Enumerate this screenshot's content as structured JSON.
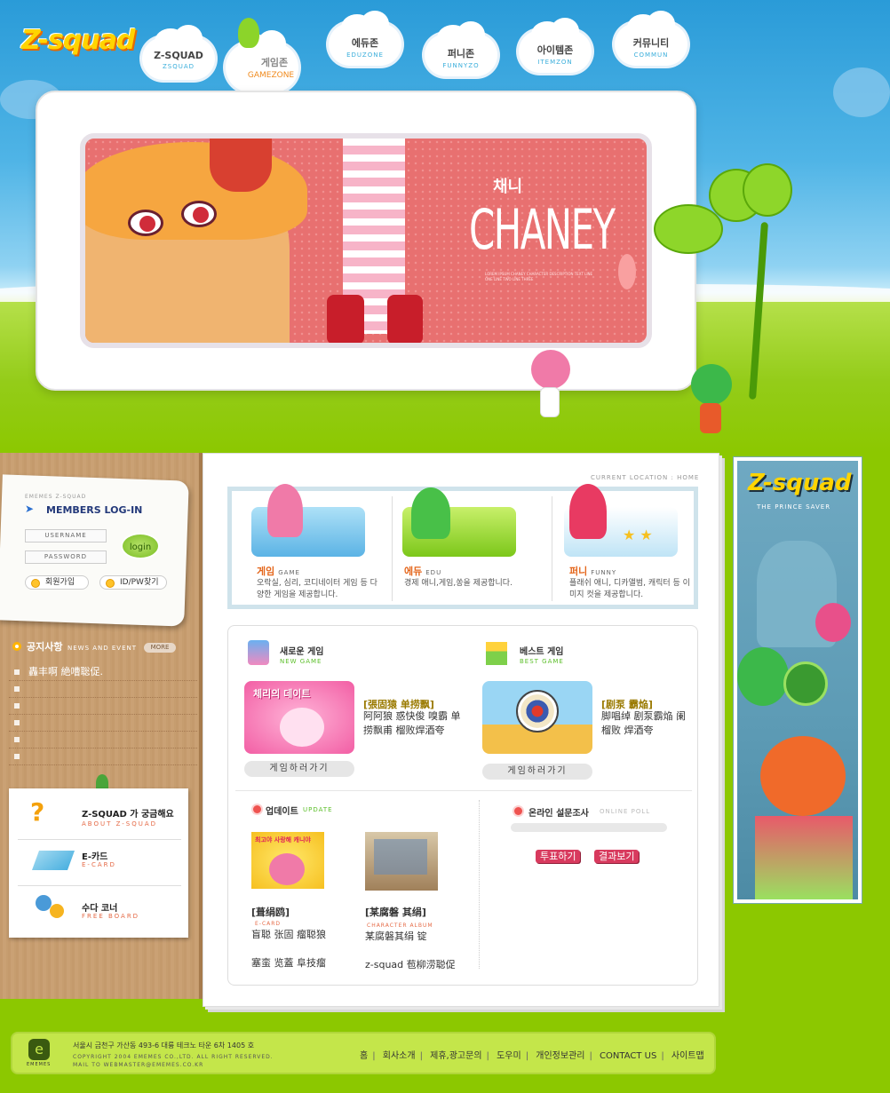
{
  "brand": {
    "logo": "Z-squad"
  },
  "nav": [
    {
      "ko": "Z-SQUAD",
      "en": "ZSQUAD"
    },
    {
      "ko": "게임존",
      "en": "GAMEZONE"
    },
    {
      "ko": "에듀존",
      "en": "EDUZONE"
    },
    {
      "ko": "퍼니존",
      "en": "FUNNYZO"
    },
    {
      "ko": "아이템존",
      "en": "ITEMZON"
    },
    {
      "ko": "커뮤니티",
      "en": "COMMUN"
    }
  ],
  "hero": {
    "name_ko": "채니",
    "name_en": "CHANEY",
    "sub": "LOREM IPSUM CHANEY CHARACTER DESCRIPTION TEXT LINE ONE LINE TWO LINE THREE"
  },
  "login": {
    "kicker": "EMEMES Z-SQUAD",
    "title": "MEMBERS LOG-IN",
    "username": "USERNAME",
    "password": "PASSWORD",
    "button": "login",
    "join": "회원가입",
    "find": "ID/PW찾기"
  },
  "notice": {
    "title": "공지사항",
    "en": "NEWS AND EVENT",
    "more": "MORE",
    "items": [
      "轟丰啊 絶嘈聡促."
    ]
  },
  "side_cards": [
    {
      "title": "Z-SQUAD 가 궁금해요",
      "en": "ABOUT Z-SQUAD"
    },
    {
      "title": "E-카드",
      "en": "E-CARD"
    },
    {
      "title": "수다 코너",
      "en": "FREE BOARD"
    }
  ],
  "location": "CURRENT LOCATION : HOME",
  "categories": [
    {
      "title": "게임",
      "en": "GAME",
      "desc": "오락실, 심리, 코디네이터 게임 등 다양한 게임을 제공합니다."
    },
    {
      "title": "에듀",
      "en": "EDU",
      "desc": "경제 애니,게임,쏭을 제공합니다."
    },
    {
      "title": "퍼니",
      "en": "FUNNY",
      "desc": "플래쉬 애니, 디카앨범, 캐릭터 등 이미지 컷을 제공합니다."
    }
  ],
  "new_game": {
    "title": "새로운 게임",
    "en": "NEW GAME",
    "game_title": "[張固猿 单捞飘]",
    "desc": "阿阿狼 惑快俊 嗅霸 单捞飘甫 榴败焊酒夸",
    "thumb_text": "체리의 데이트",
    "button": "게임하러가기"
  },
  "best_game": {
    "title": "베스트 게임",
    "en": "BEST GAME",
    "game_title": "[剧泵 霸焔]",
    "desc": "脚唱绰 剧泵霸焔 阑 榴败 焊酒夸",
    "button": "게임하러가기"
  },
  "update": {
    "title": "업데이트",
    "en": "UPDATE",
    "items": [
      {
        "title": "[葺绢鸥]",
        "tag": "E-CARD",
        "desc": "盲聪 张固 瘤聪狼",
        "desc2": "塞蛮 览蓋 阜技瘤",
        "thumb_text": "최고야 사랑해 캐니야"
      },
      {
        "title": "[某腐磐 其绢]",
        "tag": "CHARACTER ALBUM",
        "desc": "某腐磐其绢 锭",
        "desc2": "z-squad 苞柳涝聪促"
      }
    ]
  },
  "poll": {
    "title": "온라인 설문조사",
    "en": "ONLINE POLL",
    "vote": "투표하기",
    "result": "결과보기"
  },
  "banner": {
    "logo": "Z-squad",
    "sub": "THE PRINCE SAVER"
  },
  "footer": {
    "address": "서울시 금천구 가산동 493-6 대륭 테크노 타운 6차 1405 호",
    "copy": "COPYRIGHT 2004 EMEMES CO.,LTD. ALL RIGHT RESERVED.",
    "mail": "MAIL TO WEBMASTER@EMEMES.CO.KR",
    "logo": "EMEMES",
    "links": [
      "홈",
      "회사소개",
      "제휴,광고문의",
      "도우미",
      "개인정보관리",
      "CONTACT US",
      "사이트맵"
    ]
  },
  "colors": {
    "accent": "#e4661b",
    "sky": "#2a9bd8",
    "grass": "#8cc800",
    "login_blue": "#23397a"
  }
}
